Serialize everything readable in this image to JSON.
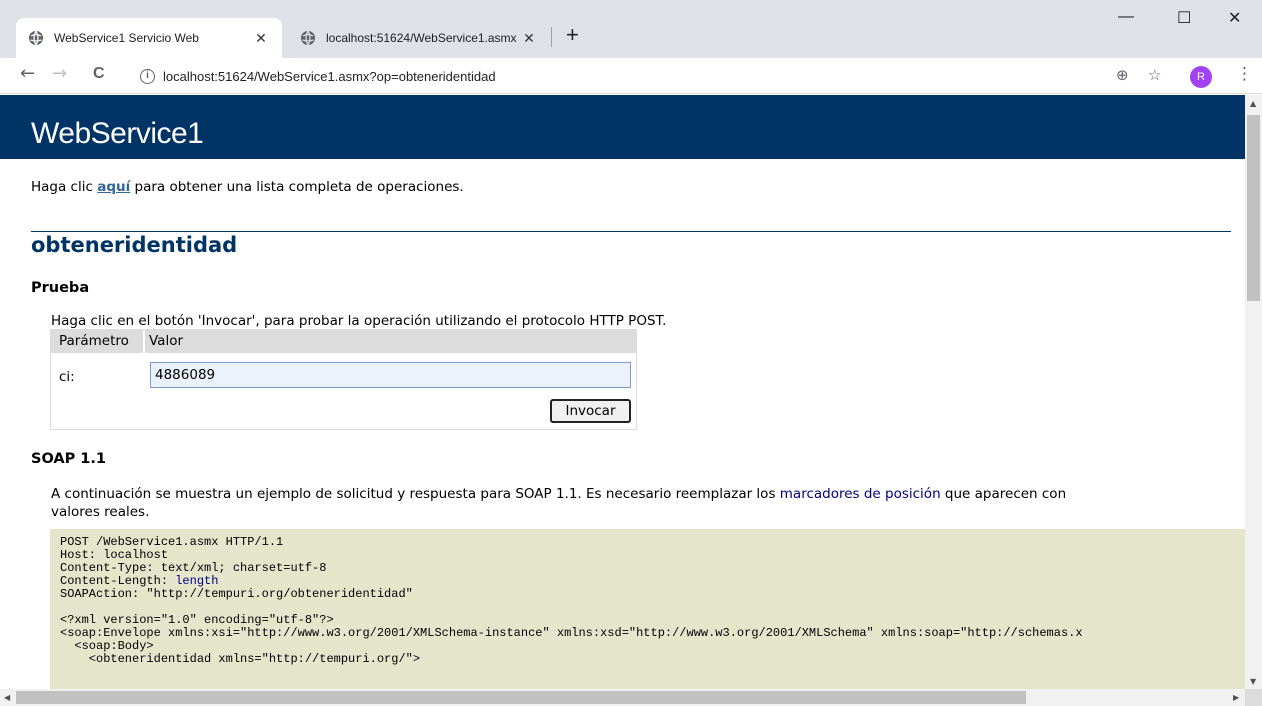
{
  "browser": {
    "tabs": [
      {
        "title": "WebService1 Servicio Web",
        "close": "✕"
      },
      {
        "title": "localhost:51624/WebService1.asmx",
        "close": "✕"
      }
    ],
    "new_tab": "+",
    "window_controls": {
      "minimize": "—",
      "maximize": "☐",
      "close": "✕"
    },
    "nav": {
      "back": "←",
      "forward": "→",
      "reload": "C"
    },
    "url": "localhost:51624/WebService1.asmx?op=obteneridentidad",
    "info_glyph": "i",
    "toolbar_icons": {
      "zoom": "⊕",
      "star": "☆",
      "menu": "⋮"
    },
    "profile_initial": "R"
  },
  "page": {
    "banner_title": "WebService1",
    "intro_prefix": "Haga clic ",
    "intro_link": "aquí",
    "intro_suffix": " para obtener una lista completa de operaciones.",
    "operation_name": "obteneridentidad",
    "test": {
      "heading": "Prueba",
      "description": "Haga clic en el botón 'Invocar', para probar la operación utilizando el protocolo HTTP POST.",
      "col_param": "Parámetro",
      "col_value": "Valor",
      "param_label": "ci:",
      "param_value": "4886089",
      "invoke_label": "Invocar"
    },
    "soap": {
      "heading": "SOAP 1.1",
      "desc_part1": "A continuación se muestra un ejemplo de solicitud y respuesta para SOAP 1.1. Es necesario reemplazar los ",
      "desc_link": "marcadores de posición",
      "desc_part2": " que aparecen con",
      "desc_line2": "valores reales.",
      "code_line1": "POST /WebService1.asmx HTTP/1.1",
      "code_line2": "Host: localhost",
      "code_line3": "Content-Type: text/xml; charset=utf-8",
      "code_line4_prefix": "Content-Length: ",
      "code_line4_ph": "length",
      "code_line5": "SOAPAction: \"http://tempuri.org/obteneridentidad\"",
      "code_line7": "<?xml version=\"1.0\" encoding=\"utf-8\"?>",
      "code_line8": "<soap:Envelope xmlns:xsi=\"http://www.w3.org/2001/XMLSchema-instance\" xmlns:xsd=\"http://www.w3.org/2001/XMLSchema\" xmlns:soap=\"http://schemas.x",
      "code_line9": "  <soap:Body>",
      "code_line10": "    <obteneridentidad xmlns=\"http://tempuri.org/\">"
    }
  },
  "scroll": {
    "up": "▲",
    "down": "▼",
    "left": "◀",
    "right": "▶"
  },
  "colors": {
    "banner": "#003366",
    "heading": "#003366",
    "code_bg": "#e5e5cc",
    "link": "#336699"
  }
}
